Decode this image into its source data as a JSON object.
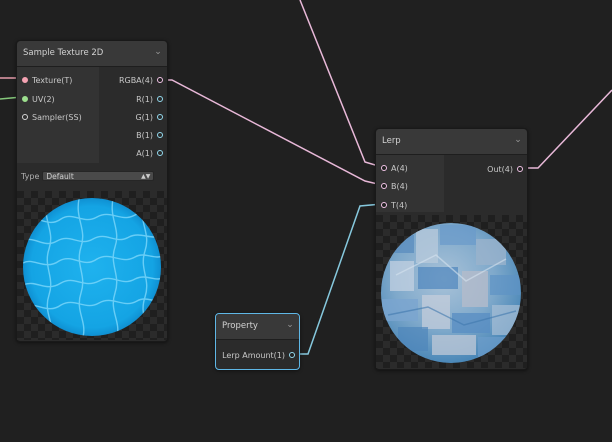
{
  "colors": {
    "background": "#202020",
    "wire_texture": "#e49aa9",
    "wire_uv": "#85c87b",
    "wire_vector4": "#e8b8d8",
    "wire_float": "#86c8dd",
    "port_texture": "#f5a3b3",
    "port_uv": "#9ddf8e",
    "port_sampler": "#d6d6d6",
    "port_vector4": "#f0c3e6",
    "port_float": "#93d9ee",
    "selection": "#5fb7e6"
  },
  "sample_texture_node": {
    "title": "Sample Texture 2D",
    "collapse_icon": "chevron-down-icon",
    "inputs": [
      {
        "label": "Texture(T)",
        "color": "#f5a3b3"
      },
      {
        "label": "UV(2)",
        "color": "#9ddf8e"
      },
      {
        "label": "Sampler(SS)",
        "color": "#d6d6d6"
      }
    ],
    "outputs": [
      {
        "label": "RGBA(4)",
        "color": "#f0c3e6"
      },
      {
        "label": "R(1)",
        "color": "#93d9ee"
      },
      {
        "label": "G(1)",
        "color": "#93d9ee"
      },
      {
        "label": "B(1)",
        "color": "#93d9ee"
      },
      {
        "label": "A(1)",
        "color": "#93d9ee"
      }
    ],
    "type_label": "Type",
    "type_value": "Default"
  },
  "lerp_node": {
    "title": "Lerp",
    "collapse_icon": "chevron-down-icon",
    "inputs": [
      {
        "label": "A(4)",
        "color": "#f0c3e6"
      },
      {
        "label": "B(4)",
        "color": "#f0c3e6"
      },
      {
        "label": "T(4)",
        "color": "#f0c3e6"
      }
    ],
    "outputs": [
      {
        "label": "Out(4)",
        "color": "#f0c3e6"
      }
    ]
  },
  "property_node": {
    "title": "Property",
    "collapse_icon": "chevron-down-icon",
    "outputs": [
      {
        "label": "Lerp Amount(1)",
        "color": "#93d9ee"
      }
    ],
    "selected": true
  }
}
